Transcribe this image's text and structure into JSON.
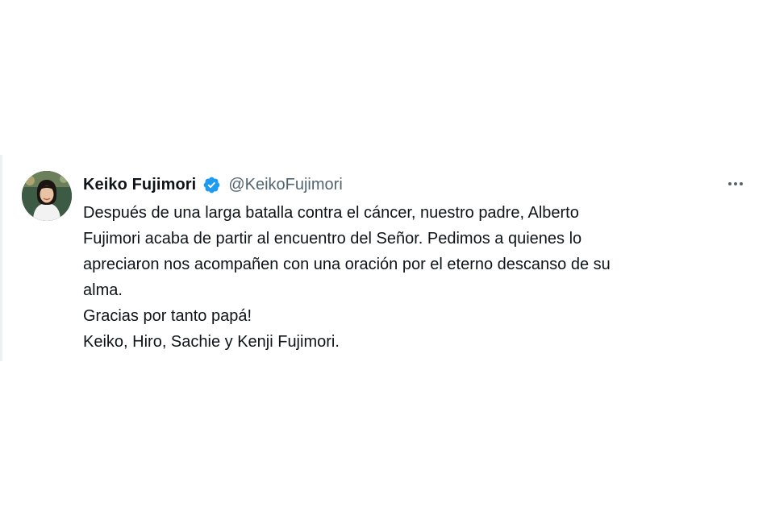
{
  "tweet": {
    "author": {
      "display_name": "Keiko Fujimori",
      "handle": "@KeikoFujimori",
      "verified": true,
      "avatar_icon": "profile-photo"
    },
    "more_icon": "more-horizontal-icon",
    "lines": [
      "Después de una larga batalla contra el cáncer, nuestro padre, Alberto",
      "Fujimori acaba de partir al encuentro del Señor. Pedimos a quienes lo",
      "apreciaron nos acompañen con una oración por el eterno descanso de su",
      "alma.",
      "Gracias por tanto papá!",
      "Keiko, Hiro, Sachie y Kenji Fujimori."
    ]
  },
  "colors": {
    "text": "#0f1419",
    "secondary_text": "#536471",
    "verified_badge": "#1d9bf0",
    "background": "#ffffff"
  }
}
